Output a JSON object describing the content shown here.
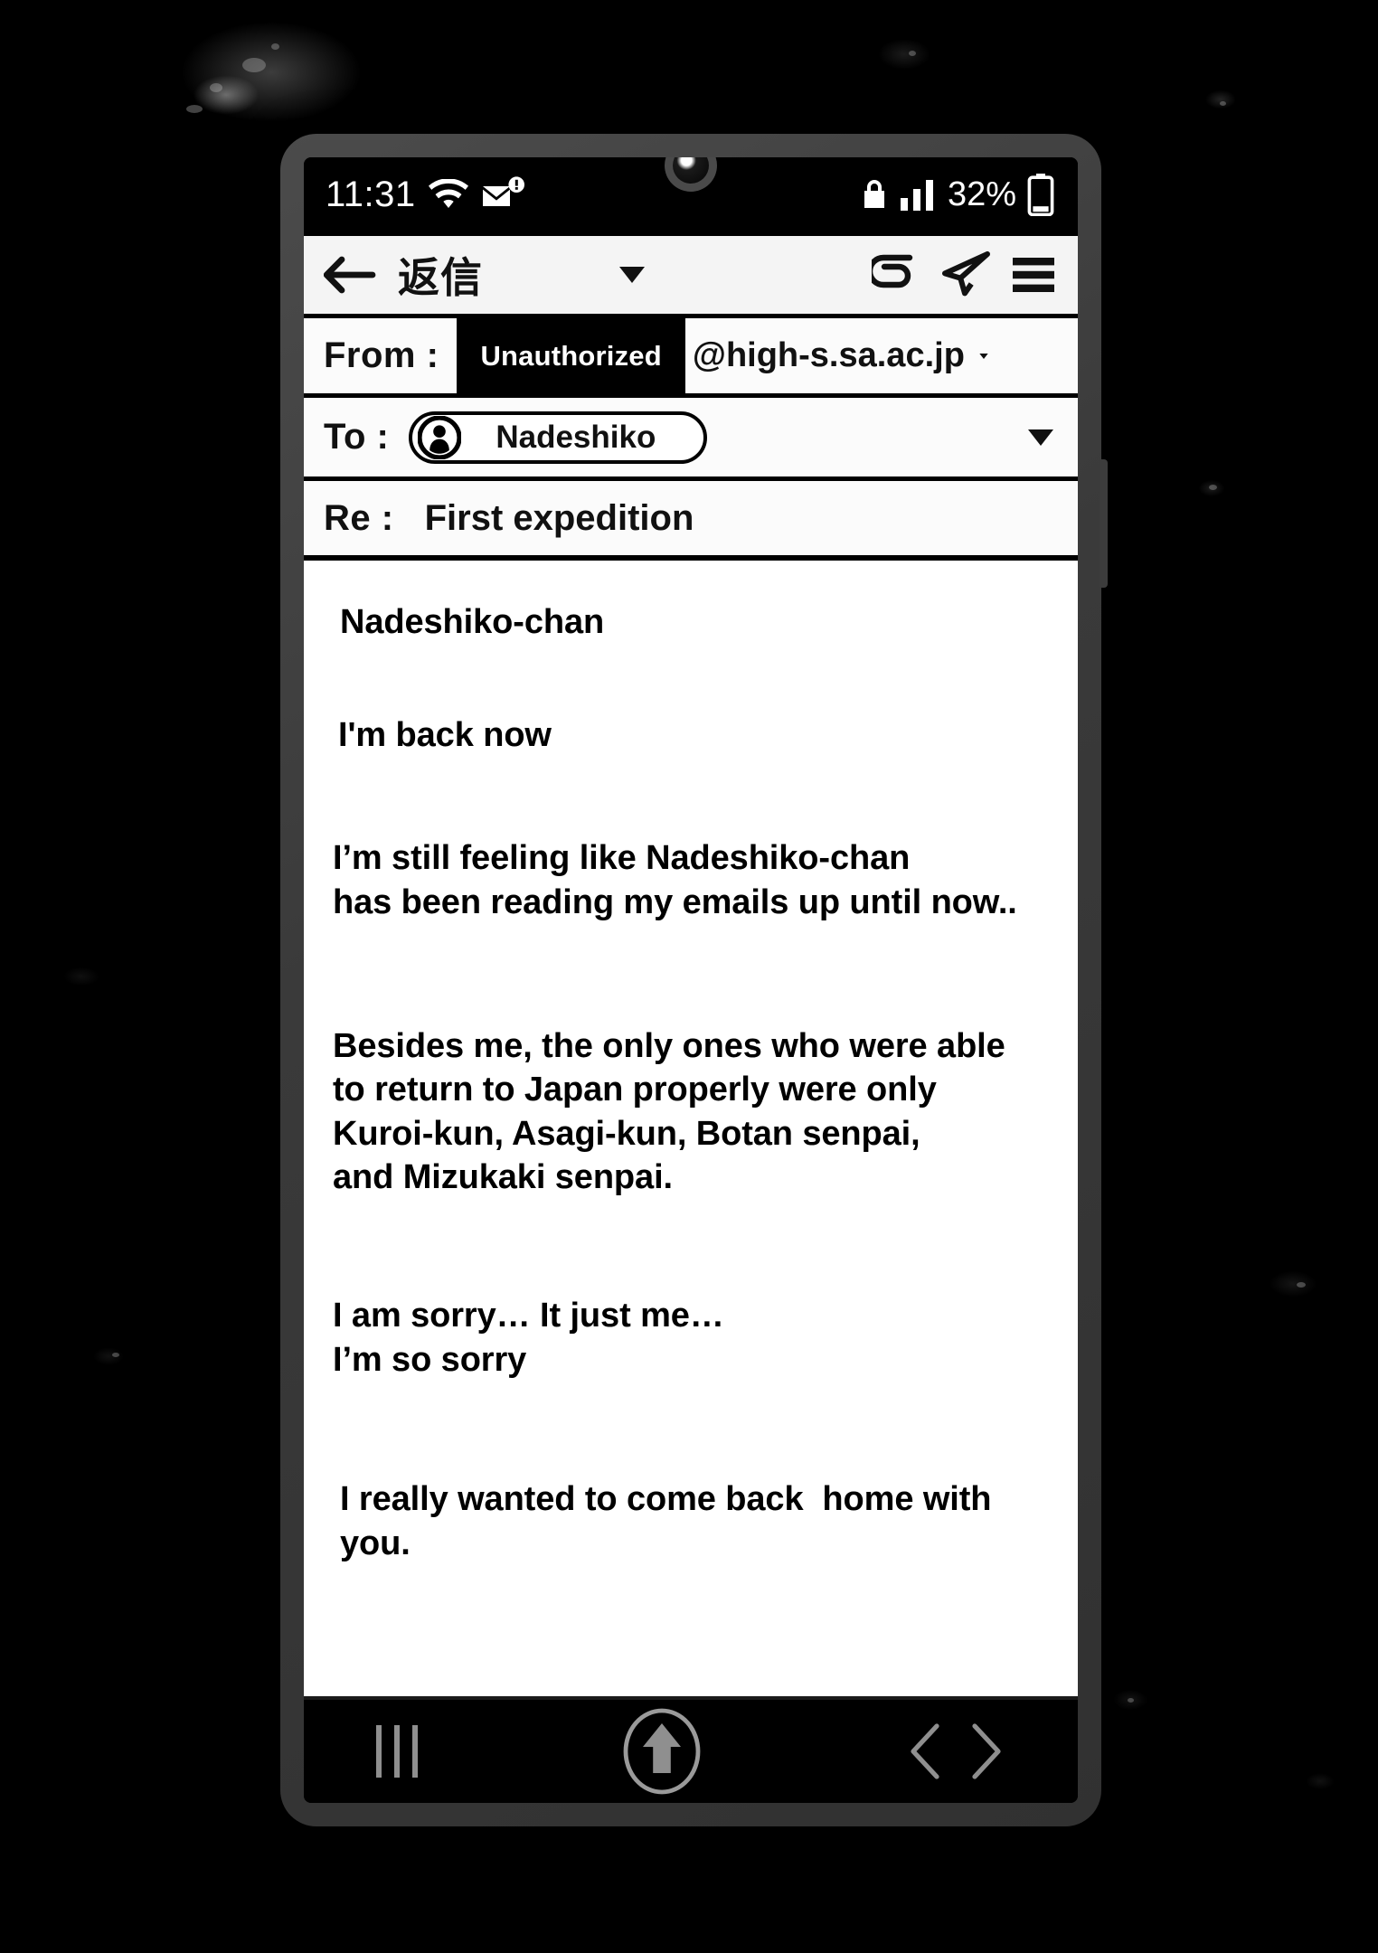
{
  "status_bar": {
    "time": "11:31",
    "wifi_icon": "wifi-icon",
    "mail_alert_icon": "mail-alert-icon",
    "lock_icon": "lock-icon",
    "signal_icon": "signal-bars-icon",
    "battery_percent": "32%",
    "battery_icon": "battery-low-icon"
  },
  "toolbar": {
    "back_icon": "back-arrow-icon",
    "title": "返信",
    "caret_icon": "chevron-down-icon",
    "attach_icon": "attachment-icon",
    "send_icon": "send-paper-plane-icon",
    "menu_icon": "hamburger-menu-icon"
  },
  "compose": {
    "from": {
      "label": "From :",
      "redacted_value": "Unauthorized",
      "domain": "@high-s.sa.ac.jp",
      "caret_icon": "chevron-down-icon"
    },
    "to": {
      "label": "To :",
      "recipient": "Nadeshiko",
      "avatar_icon": "contact-avatar-icon",
      "caret_icon": "chevron-down-icon"
    },
    "subject": {
      "label": "Re :",
      "value": "First expedition"
    },
    "body": {
      "greeting": "Nadeshiko-chan",
      "line_back": "I'm back now",
      "para_feeling": "I’m still feeling like Nadeshiko-chan\nhas been reading my emails up until now..",
      "para_members": "Besides me, the only ones who were able\nto return to Japan properly were only\nKuroi-kun, Asagi-kun, Botan senpai,\nand Mizukaki senpai.",
      "para_sorry": "I am sorry… It just me…\nI’m so sorry",
      "para_home": "I really wanted to come back  home with you."
    }
  },
  "navbar": {
    "recents_icon": "recents-bars-icon",
    "home_icon": "home-up-arrow-icon",
    "back_chevron_icon": "chevron-left-icon",
    "forward_chevron_icon": "chevron-right-icon"
  },
  "colors": {
    "background": "#000000",
    "device_frame": "#3a3a3a",
    "chrome": "#f4f4f4",
    "text": "#000000",
    "nav_icon": "#8f8f8f"
  }
}
